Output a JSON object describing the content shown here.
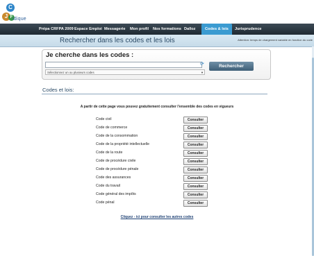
{
  "logo": {
    "letter1": "C",
    "letter2": "J",
    "letter3": "F",
    "word": "idique"
  },
  "nav": {
    "items": [
      "Prépa CRFPA 2009",
      "Espace Emploi",
      "Messagerie",
      "Mon profil",
      "Nos formations",
      "Dalloz",
      "Codes & lois",
      "Jurisprudence"
    ],
    "active_index": 6
  },
  "header": {
    "title": "Rechercher dans les codes et les lois",
    "warning": "Attention: temps de chargement variable en fonction du code"
  },
  "search": {
    "label": "Je cherche dans les codes :",
    "input_value": "",
    "select_value": "Sélectionnez un ou plusieurs codes",
    "button": "Rechercher"
  },
  "codes": {
    "title": "Codes et lois:",
    "intro": "A partir de cette page vous pouvez gratuitement consulter l'ensemble des codes en vigueurs",
    "button_label": "Consulter",
    "items": [
      "Code civil",
      "Code de commerce",
      "Code de la consommation",
      "Code de la propriété intellectuelle",
      "Code de la route",
      "Code de procédure civile",
      "Code de procédure pénale",
      "Code des assurances",
      "Code du travail",
      "Code général des impôts",
      "Code pénal"
    ]
  },
  "footer_link": "Cliquez - ici pour consulter les autres codes",
  "colors": {
    "nav_bg": "#2a3640",
    "active_tab": "#3b9bd1",
    "search_button": "#4d6d85",
    "link": "#1c3f73"
  }
}
